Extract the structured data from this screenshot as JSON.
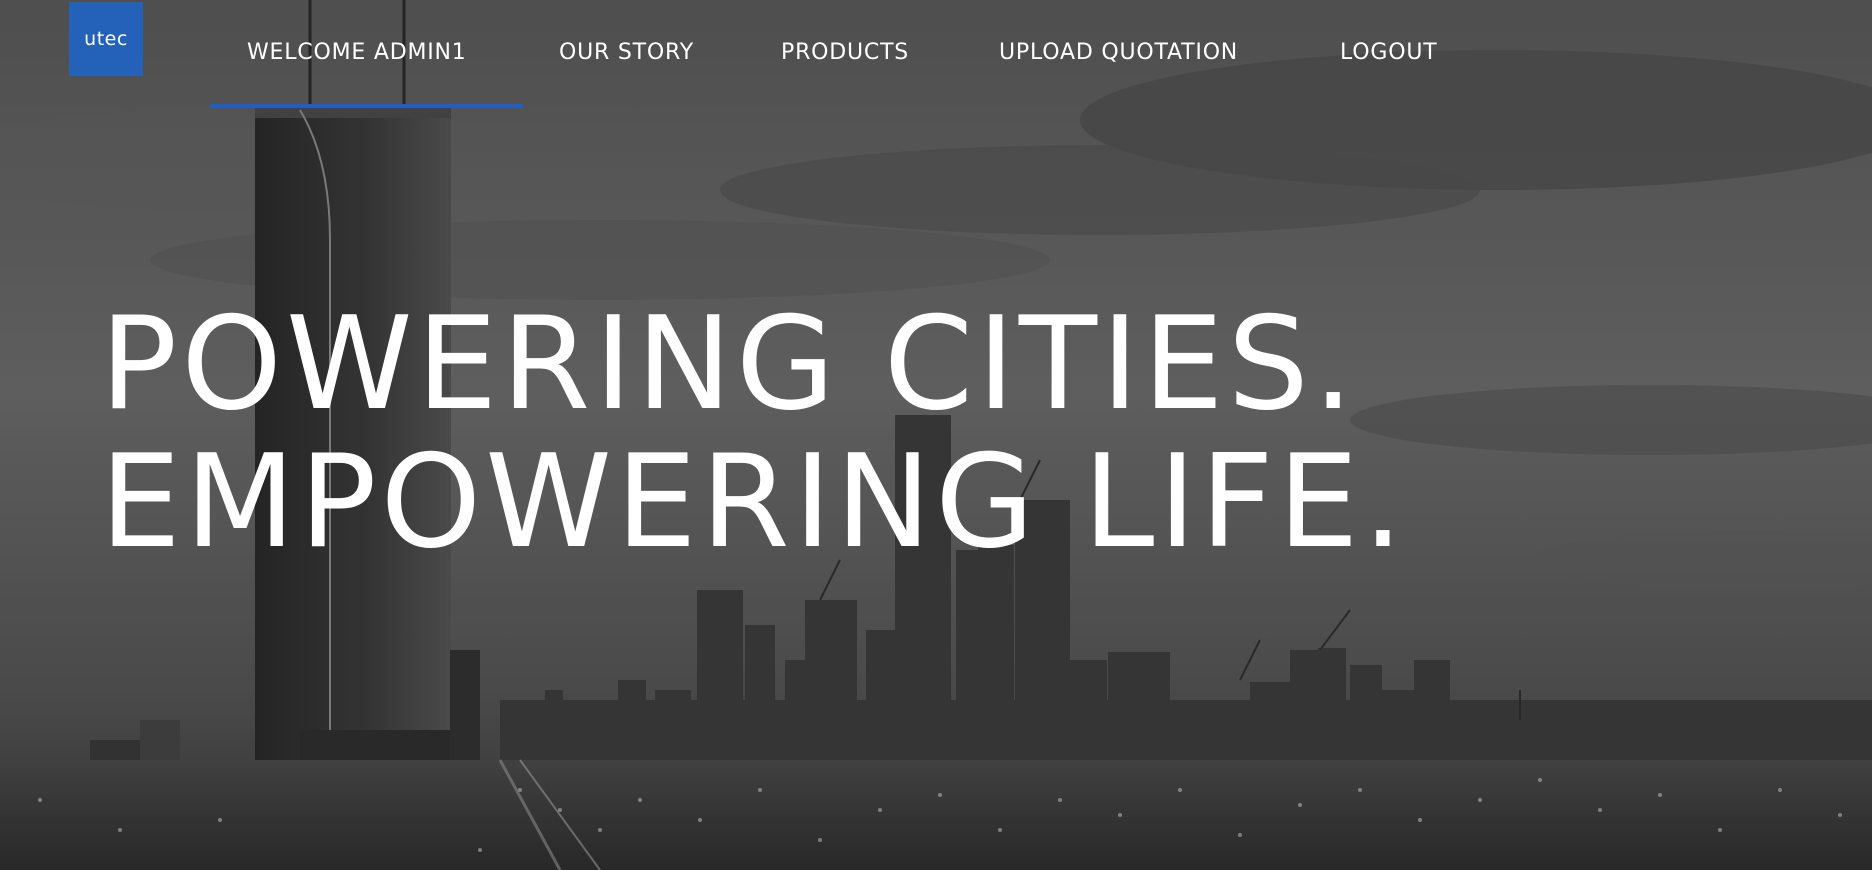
{
  "header": {
    "logo_text": "utec",
    "nav": [
      {
        "label": "WELCOME ADMIN1",
        "active": true
      },
      {
        "label": "OUR STORY"
      },
      {
        "label": "PRODUCTS"
      },
      {
        "label": "UPLOAD QUOTATION"
      },
      {
        "label": "LOGOUT"
      }
    ]
  },
  "hero": {
    "line1": "POWERING CITIES.",
    "line2": "EMPOWERING LIFE."
  },
  "colors": {
    "brand_blue": "#2461b8",
    "active_underline": "#1f5fc4",
    "text": "#ffffff"
  }
}
